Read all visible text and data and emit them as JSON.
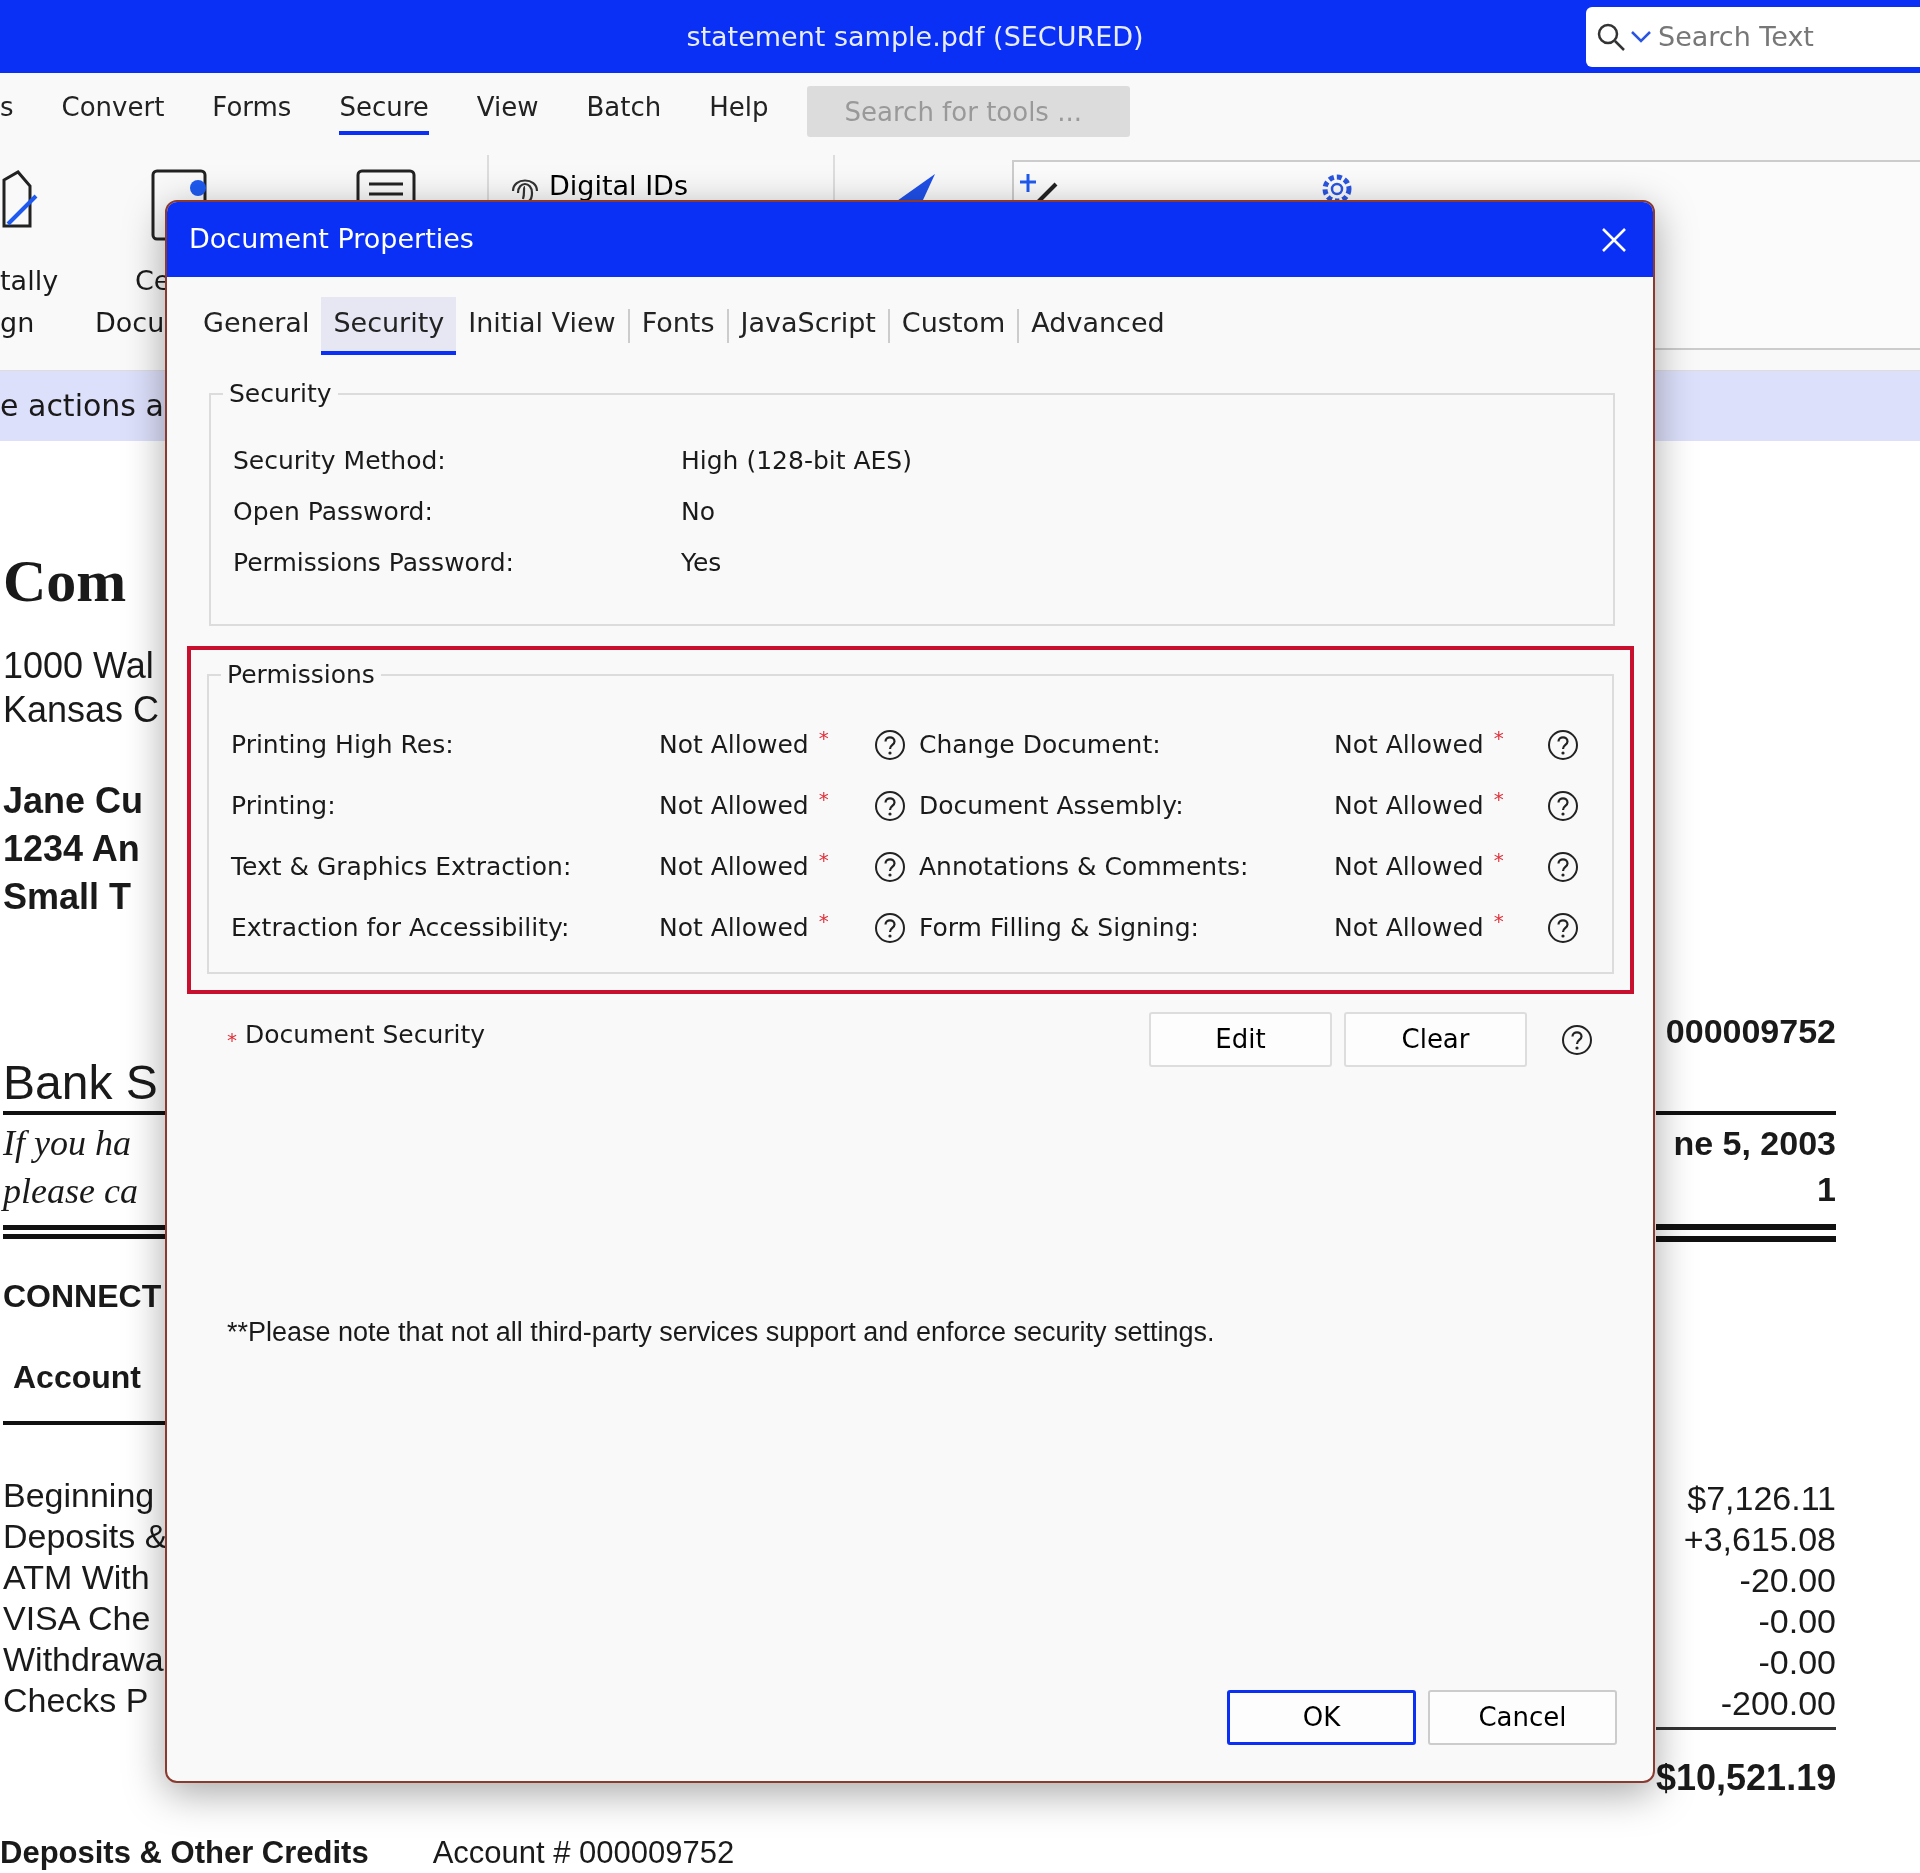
{
  "app": {
    "title": "statement sample.pdf (SECURED)",
    "search": {
      "placeholder": "Search Text"
    }
  },
  "menu": [
    {
      "label": "s",
      "selected": false
    },
    {
      "label": "Convert",
      "selected": false
    },
    {
      "label": "Forms",
      "selected": false
    },
    {
      "label": "Secure",
      "selected": true
    },
    {
      "label": "View",
      "selected": false
    },
    {
      "label": "Batch",
      "selected": false
    },
    {
      "label": "Help",
      "selected": false
    }
  ],
  "tool_search": {
    "placeholder": "Search for tools ..."
  },
  "ribbon": [
    {
      "kind": "sign",
      "lines": [
        "tally",
        "gn"
      ]
    },
    {
      "kind": "certify",
      "lines": [
        "Ce",
        "Docu"
      ]
    },
    {
      "kind": "list"
    },
    {
      "kind": "ids",
      "label": "Digital IDs"
    },
    {
      "kind": "pen"
    },
    {
      "kind": "panel"
    }
  ],
  "info_bar": "e actions a",
  "document": {
    "left": [
      {
        "kind": "logo",
        "lines": [
          "Com"
        ]
      },
      {
        "kind": "address",
        "lines": [
          "1000 Wal",
          "Kansas C"
        ]
      },
      {
        "kind": "recipient",
        "lines": [
          "Jane Cu",
          "1234 An",
          "Small T"
        ]
      },
      {
        "kind": "heading",
        "lines": [
          "Bank S"
        ]
      },
      {
        "kind": "note",
        "lines": [
          "If you ha",
          "please ca"
        ]
      },
      {
        "kind": "section",
        "lines": [
          "CONNECT"
        ]
      },
      {
        "kind": "subsection",
        "lines": [
          "Account"
        ]
      },
      {
        "kind": "summary",
        "lines": [
          "Beginning",
          "Deposits &",
          "ATM With",
          "VISA Che",
          "Withdrawa",
          "Checks P"
        ]
      }
    ],
    "right": [
      {
        "kind": "account",
        "lines": [
          "000009752"
        ]
      },
      {
        "kind": "dates",
        "lines": [
          "ne 5, 2003",
          "1"
        ]
      },
      {
        "kind": "amounts",
        "lines": [
          "$7,126.11",
          "+3,615.08",
          "-20.00",
          "-0.00",
          "-0.00",
          "-200.00"
        ]
      },
      {
        "kind": "total",
        "lines": [
          "$10,521.19"
        ]
      }
    ],
    "footer": [
      "Deposits & Other Credits",
      "Account # 000009752"
    ]
  },
  "dialog": {
    "title": "Document Properties",
    "tabs": [
      {
        "label": "General",
        "selected": false
      },
      {
        "label": "Security",
        "selected": true
      },
      {
        "label": "Initial View",
        "selected": false
      },
      {
        "label": "Fonts",
        "selected": false
      },
      {
        "label": "JavaScript",
        "selected": false
      },
      {
        "label": "Custom",
        "selected": false
      },
      {
        "label": "Advanced",
        "selected": false
      }
    ],
    "security": {
      "title": "Security",
      "rows": [
        {
          "label": "Security Method:",
          "value": "High (128-bit AES)"
        },
        {
          "label": "Open Password:",
          "value": "No"
        },
        {
          "label": "Permissions Password:",
          "value": "Yes"
        }
      ]
    },
    "permissions": {
      "title": "Permissions",
      "highlighted": true,
      "items": [
        {
          "label": "Printing High Res:",
          "value": "Not Allowed",
          "mark": "*"
        },
        {
          "label": "Change Document:",
          "value": "Not Allowed",
          "mark": "*"
        },
        {
          "label": "Printing:",
          "value": "Not Allowed",
          "mark": "*"
        },
        {
          "label": "Document Assembly:",
          "value": "Not Allowed",
          "mark": "*"
        },
        {
          "label": "Text & Graphics Extraction:",
          "value": "Not Allowed",
          "mark": "*"
        },
        {
          "label": "Annotations & Comments:",
          "value": "Not Allowed",
          "mark": "*"
        },
        {
          "label": "Extraction for Accessibility:",
          "value": "Not Allowed",
          "mark": "*"
        },
        {
          "label": "Form Filling & Signing:",
          "value": "Not Allowed",
          "mark": "*"
        }
      ]
    },
    "doc_security": {
      "mark": "*",
      "label": "Document Security",
      "buttons": [
        "Edit",
        "Clear"
      ]
    },
    "note": "**Please note that not all third-party services support and enforce security settings.",
    "buttons": [
      {
        "label": "OK",
        "primary": true
      },
      {
        "label": "Cancel",
        "primary": false
      }
    ]
  }
}
